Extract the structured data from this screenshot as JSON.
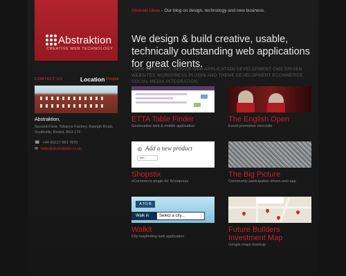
{
  "logo": {
    "name": "Abstraktion",
    "tagline": "CREATIVE WEB TECHNOLOGY"
  },
  "topbar": {
    "accent_text": "Abstrakt Ideas",
    "text": " - Our blog on design, technology and new business."
  },
  "headline": "We design & build creative, usable, technically outstanding web applications for great clients.",
  "services": "USER INTERFACE DESIGN    WEB APPLICATION DEVELOPMENT    CMS DRIVEN WEBSITES    WORDPRESS PLUGIN AND THEME DEVELOPMENT    ECOMMERCE    SOCIAL MEDIA INTEGRATION",
  "sidebar": {
    "tabs": {
      "contact": "CONTACT US",
      "location": "Location",
      "people": "People"
    },
    "company": "Abstraktion,",
    "address": "Second Floor, Tobacco Factory, Raleigh Road, Southville, Bristol, BS3 1TF",
    "phone": "+44 (0)117 963 7875",
    "email": "hello@abstraktion.co.uk"
  },
  "projects": [
    {
      "title": "ETTA Table Finder",
      "desc": "Geolocative web & mobile application"
    },
    {
      "title": "The English Open",
      "desc": "Event promotion microsite"
    },
    {
      "title": "Shopstix",
      "desc": "eCommerce plugin for Wordpress",
      "thumb_text": "Add a new product",
      "thumb_field": "Title *"
    },
    {
      "title": "The Big Picture",
      "desc": "Community participation driven web app"
    },
    {
      "title": "Walkit",
      "desc": "City wayfinding web application",
      "thumb_atob": "A TO B",
      "thumb_walkin": "Walk in",
      "thumb_select": "Select a city..."
    },
    {
      "title": "Future Builders Investment Map",
      "desc": "Google maps mashup"
    }
  ],
  "icons": {
    "phone": "phone-icon",
    "email": "email-icon",
    "logo": "dot-grid-icon"
  },
  "colors": {
    "brand_red": "#b3242d",
    "link_red": "#e0242f",
    "background": "#141414"
  }
}
